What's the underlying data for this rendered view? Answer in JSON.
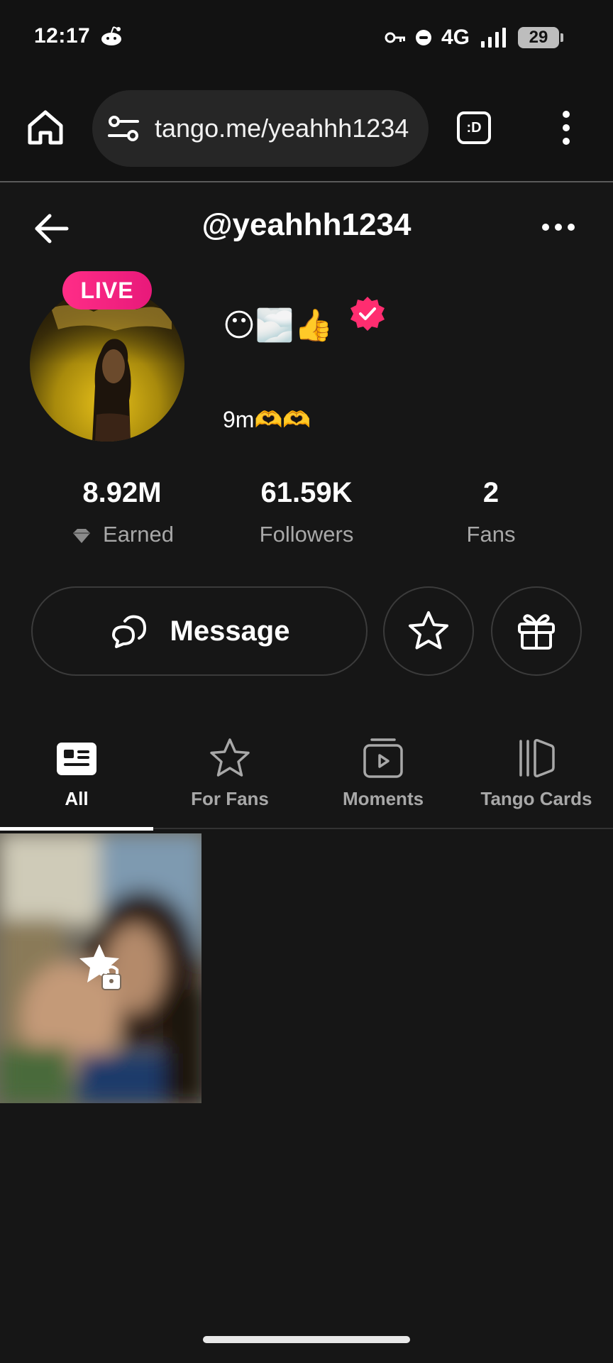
{
  "status_bar": {
    "time": "12:17",
    "network": "4G",
    "battery": "29",
    "icons": [
      "reddit-icon",
      "vpn-key-icon",
      "do-not-disturb-icon",
      "signal-icon",
      "battery-icon"
    ]
  },
  "browser": {
    "url": "tango.me/yeahhh1234",
    "tab_switcher_label": ":D",
    "icons": [
      "home-icon",
      "site-settings-icon",
      "tab-switcher-icon",
      "overflow-menu-icon"
    ]
  },
  "profile": {
    "username": "@yeahhh1234",
    "display_name": "😶🌫️👍",
    "live_label": "LIVE",
    "bio": "9m🫶🫶",
    "verified": true,
    "accent_color": "#ff2d87"
  },
  "stats": {
    "earned_value": "8.92M",
    "earned_label": "Earned",
    "followers_value": "61.59K",
    "followers_label": "Followers",
    "fans_value": "2",
    "fans_label": "Fans"
  },
  "actions": {
    "message_label": "Message",
    "icons": [
      "chat-icon",
      "star-icon",
      "gift-icon"
    ]
  },
  "tabs": [
    {
      "label": "All",
      "icon": "feed-icon",
      "active": true
    },
    {
      "label": "For Fans",
      "icon": "star-icon",
      "active": false
    },
    {
      "label": "Moments",
      "icon": "video-play-icon",
      "active": false
    },
    {
      "label": "Tango Cards",
      "icon": "cards-icon",
      "active": false
    }
  ],
  "content": {
    "items": [
      {
        "type": "locked-for-fans",
        "icon": "star-lock-icon"
      }
    ]
  }
}
